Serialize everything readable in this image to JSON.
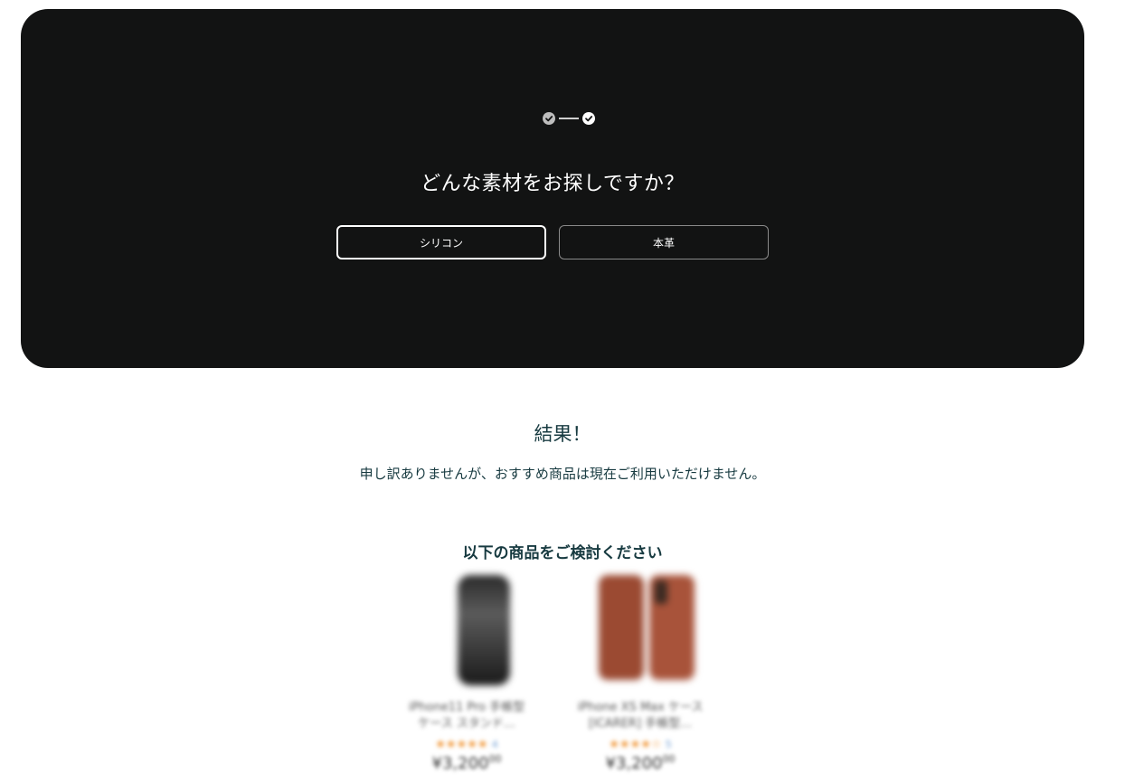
{
  "quiz": {
    "question": "どんな素材をお探しですか？",
    "options": [
      {
        "label": "シリコン",
        "selected": true
      },
      {
        "label": "本革",
        "selected": false
      }
    ],
    "steps": [
      "completed",
      "current"
    ]
  },
  "results": {
    "title": "結果！",
    "message": "申し訳ありませんが、おすすめ商品は現在ご利用いただけません。",
    "suggest_title": "以下の商品をご検討ください"
  },
  "products": [
    {
      "name_line1": "iPhone11 Pro 手帳型",
      "name_line2": "ケース スタンド…",
      "stars": "★★★★★",
      "rating_count": "4",
      "price": "¥3,200",
      "price_cents": "00",
      "image": "black-phone-case"
    },
    {
      "name_line1": "iPhone XS Max ケース",
      "name_line2": "[ICARER] 手帳型…",
      "stars": "★★★★☆",
      "rating_count": "5",
      "price": "¥3,200",
      "price_cents": "00",
      "image": "brown-leather-folio-case"
    }
  ],
  "colors": {
    "panel_bg": "#121313",
    "text_dark": "#173a40",
    "star": "#f0912c"
  }
}
